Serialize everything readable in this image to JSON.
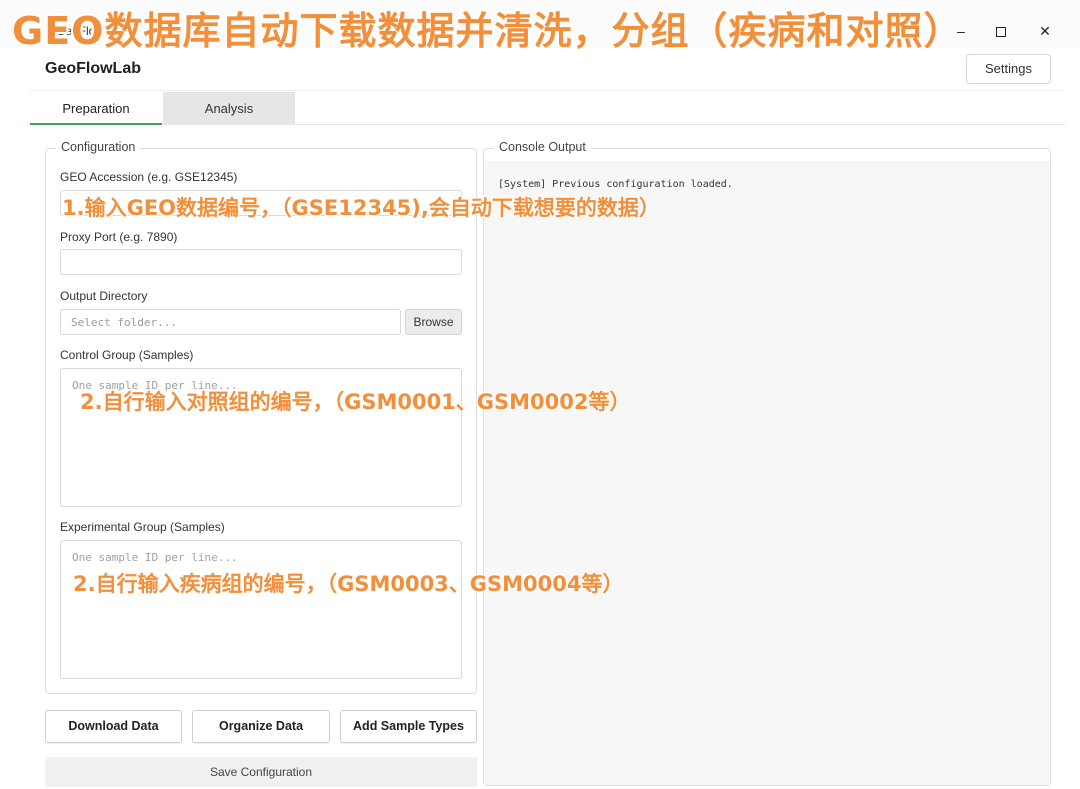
{
  "window": {
    "title": "GeoFlowLab",
    "minimize": "–",
    "close": "✕"
  },
  "banner": "GEO数据库自动下载数据并清洗，分组（疾病和对照）",
  "app": {
    "title": "GeoFlowLab",
    "settings_label": "Settings"
  },
  "tabs": [
    {
      "label": "Preparation",
      "active": true
    },
    {
      "label": "Analysis",
      "active": false
    }
  ],
  "config": {
    "title": "Configuration",
    "geo_label": "GEO Accession (e.g. GSE12345)",
    "geo_value": "",
    "proxy_label": "Proxy Port (e.g. 7890)",
    "proxy_value": "",
    "output_label": "Output Directory",
    "output_placeholder": "Select folder...",
    "browse_label": "Browse",
    "control_label": "Control Group (Samples)",
    "control_placeholder": "One sample ID per line...",
    "experimental_label": "Experimental Group (Samples)",
    "experimental_placeholder": "One sample ID per line..."
  },
  "actions": {
    "download": "Download Data",
    "organize": "Organize Data",
    "add_types": "Add Sample Types",
    "save": "Save Configuration"
  },
  "console": {
    "title": "Console Output",
    "text": "[System] Previous configuration loaded."
  },
  "annotations": {
    "step1": "1.输入GEO数据编号，（GSE12345),会自动下载想要的数据）",
    "step2": "2.自行输入对照组的编号，（GSM0001、GSM0002等）",
    "step3": "2.自行输入疾病组的编号，（GSM0003、GSM0004等）"
  },
  "accent_colors": {
    "annotation": "#f28f3b",
    "tab_underline": "#3aa05a"
  }
}
